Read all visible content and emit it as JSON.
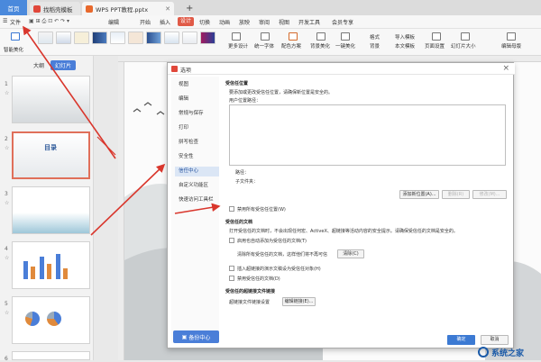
{
  "tabs": {
    "home": "首页",
    "doc1": "找稻壳模板",
    "doc2": "WPS PPT教程.pptx",
    "add": "+"
  },
  "menu": {
    "file": "文件",
    "items": [
      "编辑",
      "开始",
      "插入",
      "设计",
      "切换",
      "动画",
      "放映",
      "审阅",
      "视图",
      "开发工具",
      "会员专享"
    ]
  },
  "ribbon": {
    "smart_beautify": "智能美化",
    "more_design": "更多设计",
    "unified_font": "统一字体",
    "color_scheme": "配色方案",
    "background": "背景美化",
    "one_click_beautify": "一键美化",
    "background_btn": "背景",
    "import_template": "导入模板",
    "format": "格式",
    "this_template": "本文模板",
    "page_setup": "页面设置",
    "slide_size": "幻灯片大小",
    "edit_master": "编辑母版"
  },
  "panel": {
    "outline_tab": "大纲",
    "slides_tab": "幻灯片",
    "slide_numbers": [
      "1",
      "2",
      "3",
      "4",
      "5",
      "6"
    ],
    "slide2_title": "目录"
  },
  "dialog": {
    "title": "选项",
    "close": "×",
    "nav": [
      "视图",
      "编辑",
      "常规与保存",
      "打印",
      "拼写检查",
      "安全性",
      "信任中心",
      "自定义功能区",
      "快速访问工具栏"
    ],
    "backup": "备份中心",
    "trusted_locations": {
      "heading": "受信任位置",
      "desc": "要添加或更改受信任位置，请确保新位置是安全的。",
      "user_locations": "用户位置路径：",
      "path_label": "路径：",
      "subfolder_label": "子文件夹：",
      "add_button": "添加新位置(A)...",
      "remove_button": "删除(R)",
      "modify_button": "修改(M)...",
      "disable_all": "禁用所有受信任位置(W)"
    },
    "trusted_documents": {
      "heading": "受信任的文档",
      "desc": "打开受信任的文档时，不会出现任何宏、ActiveX、超链接等活动内容的安全提示。请确保受信任的文档是安全的。",
      "enable_auto": "启用也自动添加为受信任的文档(T)",
      "clear_desc": "清除所有受信任的文档，这样他们将不再可信",
      "clear_button": "清除(C)",
      "insert_hyperlink": "插入超链接的演示文稿设为受信任对象(H)",
      "disable_trusted": "禁用受信任的文档(D)"
    },
    "trusted_hyperlinks": {
      "heading": "受信任的超链接文件链接",
      "label": "超链接文件链接设置",
      "button": "编辑链接(E)..."
    },
    "ok": "确定",
    "cancel": "取消"
  },
  "watermark": "系统之家",
  "colors": {
    "accent": "#4a89dc",
    "design_tab": "#e05a47",
    "arrow": "#d9362c"
  }
}
